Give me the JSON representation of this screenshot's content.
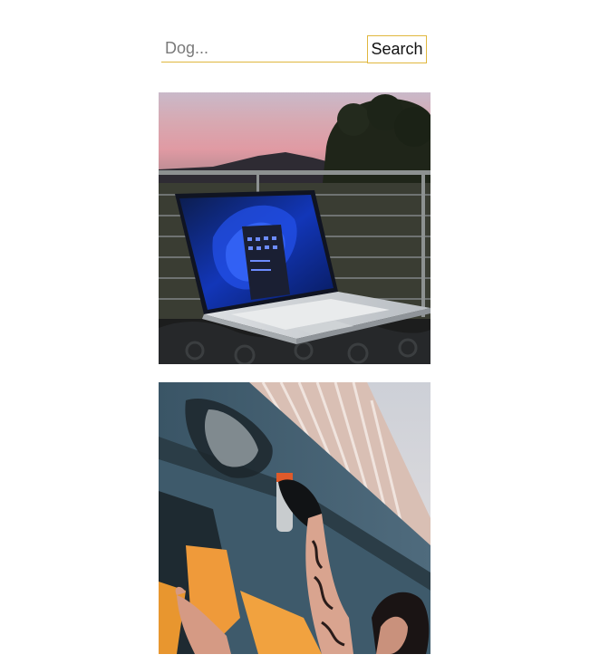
{
  "search": {
    "placeholder": "Dog...",
    "value": "",
    "button_label": "Search"
  },
  "colors": {
    "accent": "#e0b73e"
  },
  "results": [
    {
      "name": "laptop-photo"
    },
    {
      "name": "graffiti-photo"
    }
  ]
}
